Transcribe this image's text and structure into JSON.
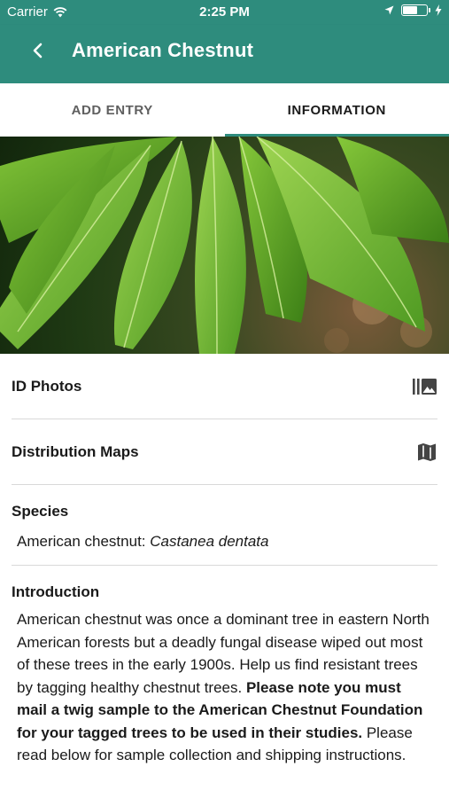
{
  "status_bar": {
    "carrier": "Carrier",
    "time": "2:25 PM",
    "battery_level": 0.6
  },
  "app_bar": {
    "title": "American Chestnut",
    "background_color": "#2e8c7d"
  },
  "tabs": [
    {
      "label": "ADD ENTRY",
      "active": false
    },
    {
      "label": "INFORMATION",
      "active": true
    }
  ],
  "hero_image": {
    "subject": "chestnut leaves photo"
  },
  "menu": {
    "id_photos_label": "ID Photos",
    "id_photos_icon": "photo-library-icon",
    "distribution_maps_label": "Distribution Maps",
    "distribution_maps_icon": "map-icon"
  },
  "species": {
    "heading": "Species",
    "common_name": "American chestnut:",
    "scientific_name": "Castanea dentata"
  },
  "introduction": {
    "heading": "Introduction",
    "text_plain_1": "American chestnut was once a dominant tree in eastern North American forests but a deadly fungal disease wiped out most of these trees in the early 1900s. Help us find resistant trees by tagging healthy chestnut trees. ",
    "text_bold": "Please note you must mail a twig sample to the American Chestnut Foundation for your tagged trees to be used in their studies.",
    "text_plain_2": "  Please read below for sample collection and shipping instructions."
  }
}
